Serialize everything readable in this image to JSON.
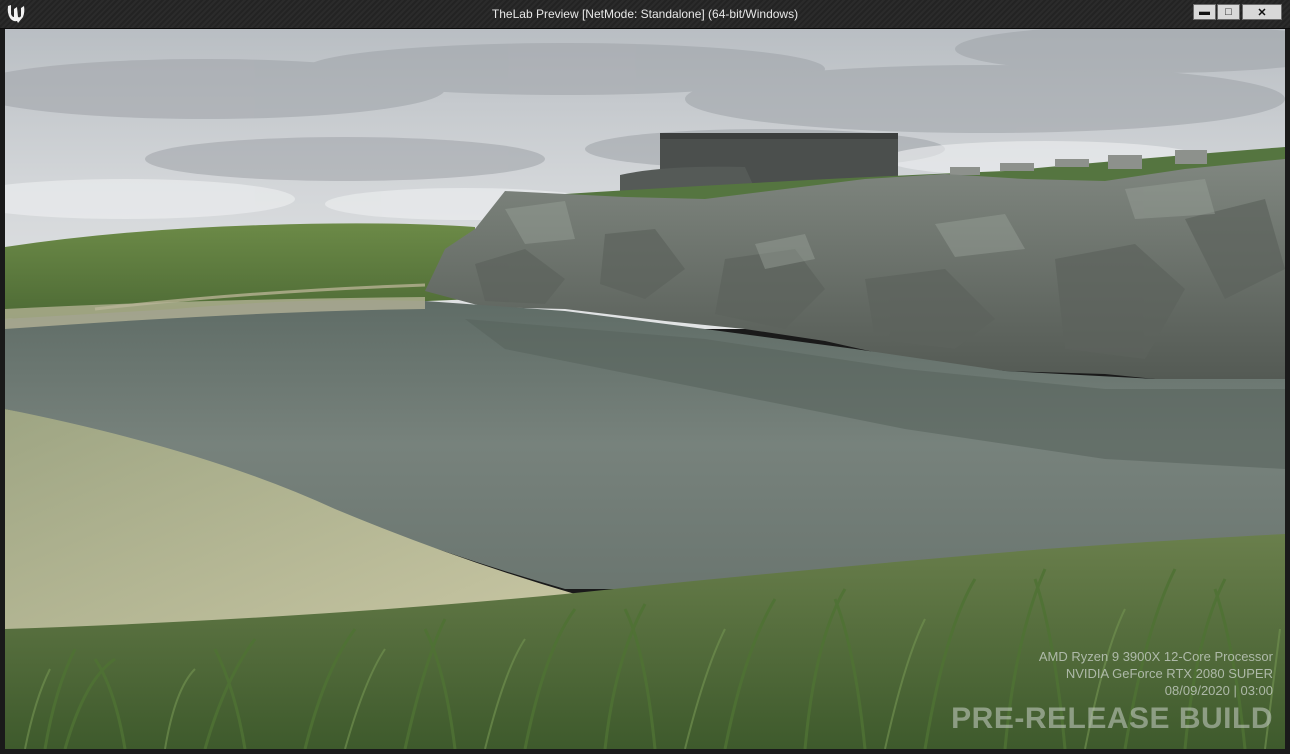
{
  "window": {
    "title": "TheLab Preview [NetMode: Standalone] (64-bit/Windows)",
    "controls": {
      "minimize": "▬",
      "maximize": "□",
      "close": "✕"
    }
  },
  "overlay": {
    "cpu": "AMD Ryzen 9 3900X 12-Core Processor",
    "gpu": "NVIDIA GeForce RTX 2080 SUPER",
    "datetime": "08/09/2020 | 03:00",
    "build_label": "PRE-RELEASE BUILD"
  },
  "scene": {
    "colors": {
      "sky_top": "#c4c8cc",
      "sky_bottom": "#dcdfe2",
      "hill": "#5e7a3e",
      "water": "#6f7b74",
      "rock": "#6f756f",
      "sand": "#b9b896",
      "grass": "#4f6e38",
      "building": "#4b4f4d"
    },
    "icons": [
      "unreal-engine-logo"
    ]
  }
}
